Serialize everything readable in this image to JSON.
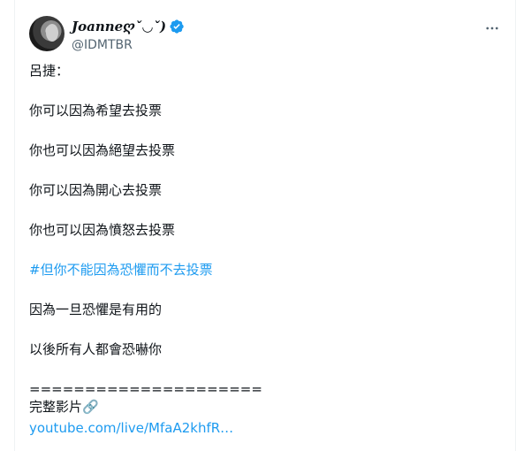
{
  "tweet": {
    "author": {
      "display_name": "𝑱𝒐𝒂𝒏𝒏𝒆ღˇ◡ˇ)",
      "handle": "@IDMTBR",
      "verified_icon": "verified-badge-icon"
    },
    "more_icon": "more-options-icon",
    "lines": {
      "l1": "呂捷：",
      "l2": "你可以因為希望去投票",
      "l3": "你也可以因為絕望去投票",
      "l4": "你可以因為開心去投票",
      "l5": "你也可以因為憤怒去投票",
      "hashtag": "#但你不能因為恐懼而不去投票",
      "l6": "因為一旦恐懼是有用的",
      "l7": "以後所有人都會恐嚇你",
      "divider": "=====================",
      "video_label": "完整影片",
      "link_icon": "🔗",
      "link": "youtube.com/live/MfaA2khfR…"
    }
  },
  "colors": {
    "accent": "#1d9bf0",
    "text": "#0f1419",
    "secondary": "#536471"
  }
}
